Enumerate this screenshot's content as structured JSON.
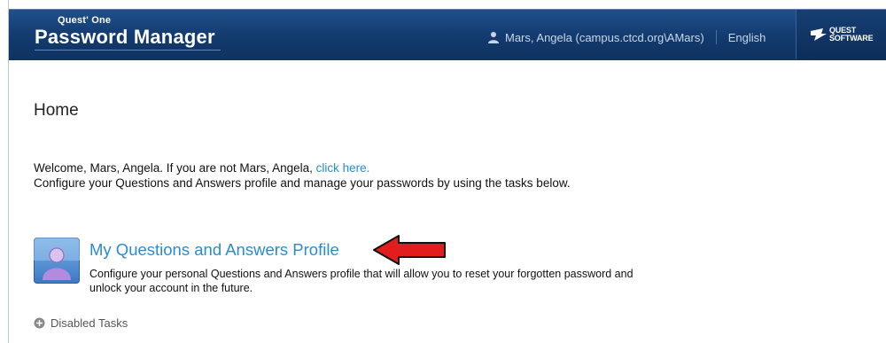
{
  "header": {
    "brand_small": "Quest' One",
    "brand_big": "Password Manager",
    "user_label": "Mars, Angela (campus.ctcd.org\\AMars)",
    "language": "English",
    "logo_line1": "QUEST",
    "logo_line2": "SOFTWARE",
    "user_icon": "user-icon",
    "logo_icon": "quest-logo-icon"
  },
  "main": {
    "title": "Home",
    "welcome_prefix": "Welcome, Mars, Angela. If you are not Mars, Angela, ",
    "welcome_link": "click here.",
    "welcome_line2": "Configure your Questions and Answers profile and manage your passwords by using the tasks below."
  },
  "task": {
    "title": "My Questions and Answers Profile",
    "description": "Configure your personal Questions and Answers profile that will allow you to reset your forgotten password and unlock your account in the future.",
    "icon": "profile-icon"
  },
  "disabled_tasks": {
    "label": "Disabled Tasks",
    "icon": "plus-icon"
  },
  "colors": {
    "header_bg": "#123a6d",
    "link": "#2a8bd1",
    "arrow": "#e11d1d"
  }
}
